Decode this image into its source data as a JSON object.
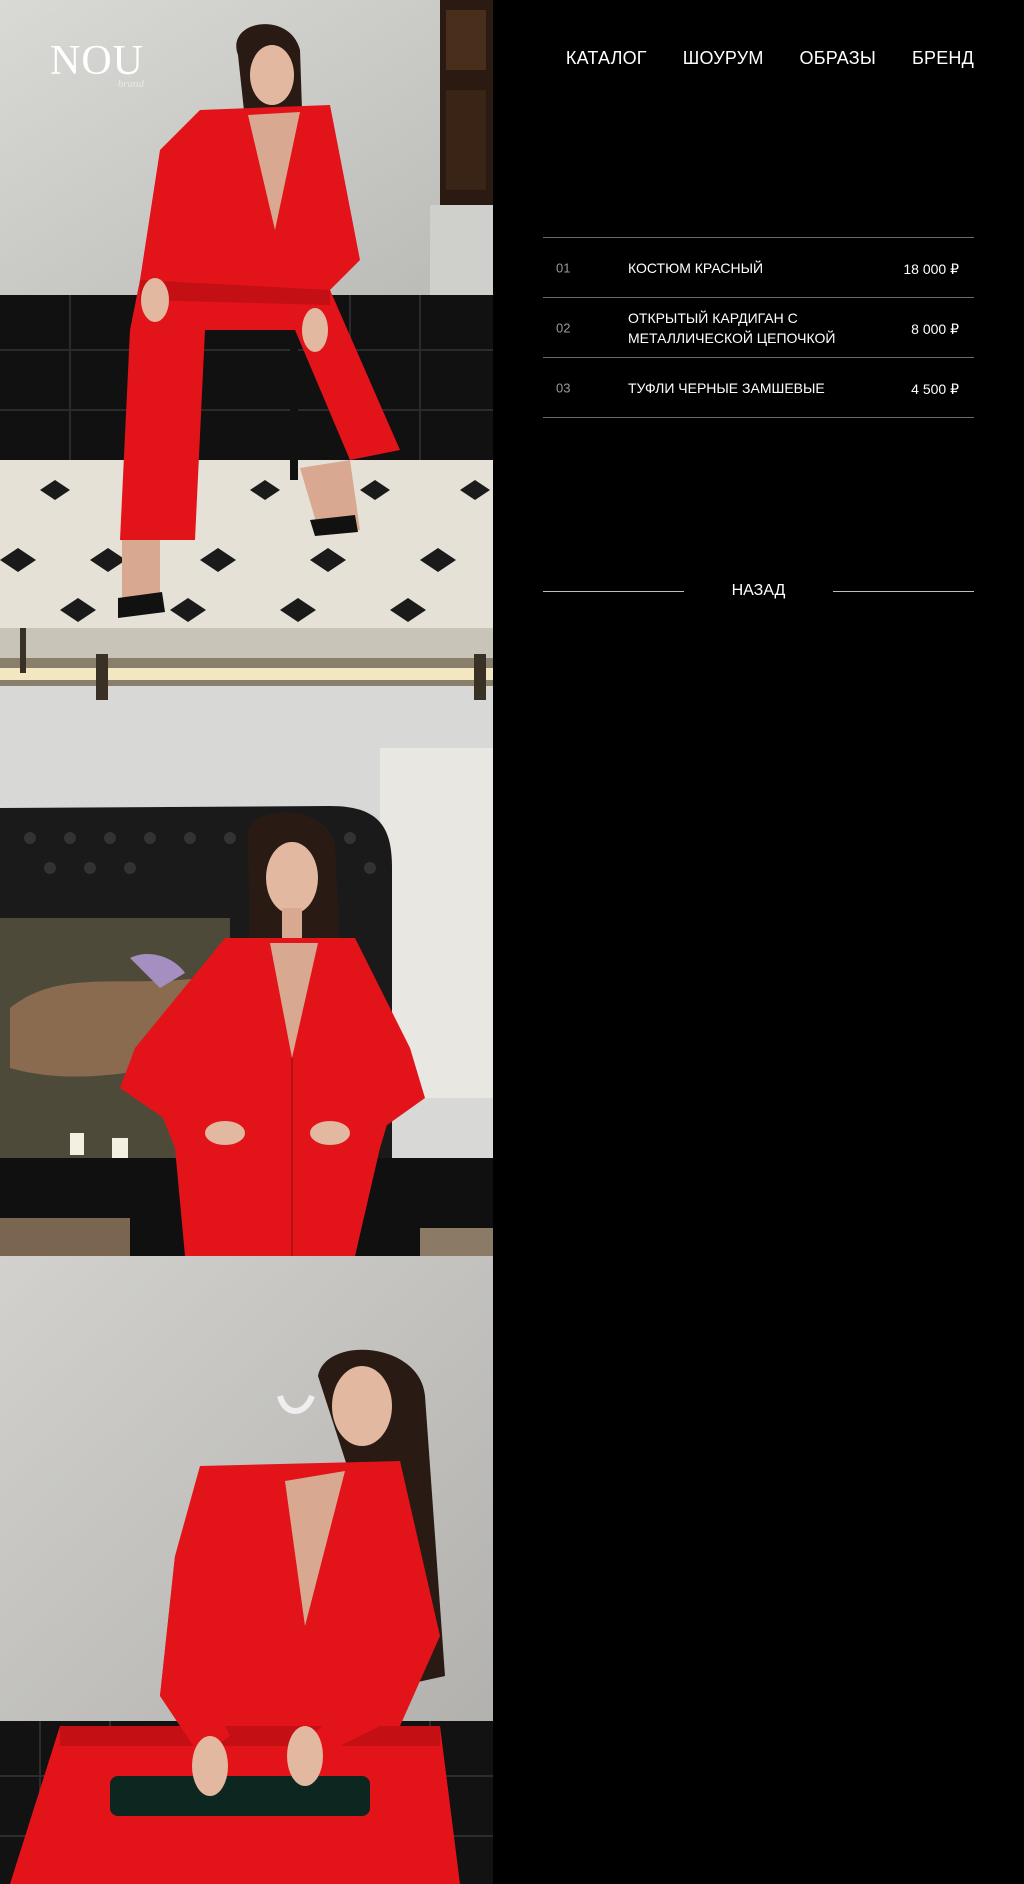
{
  "brand": {
    "logo_text": "NOU",
    "logo_sub": "brand"
  },
  "nav": {
    "items": [
      {
        "label": "КАТАЛОГ"
      },
      {
        "label": "ШОУРУМ"
      },
      {
        "label": "ОБРАЗЫ"
      },
      {
        "label": "БРЕНД"
      }
    ]
  },
  "products": [
    {
      "num": "01",
      "name": "КОСТЮМ КРАСНЫЙ",
      "price": "18 000 ₽"
    },
    {
      "num": "02",
      "name": "ОТКРЫТЫЙ КАРДИГАН С МЕТАЛЛИЧЕСКОЙ ЦЕПОЧКОЙ",
      "price": "8 000 ₽"
    },
    {
      "num": "03",
      "name": "ТУФЛИ ЧЕРНЫЕ ЗАМШЕВЫЕ",
      "price": "4 500 ₽"
    }
  ],
  "back_label": "НАЗАД",
  "colors": {
    "background": "#000000",
    "suit_red": "#e2141a",
    "divider": "#6a6a6a"
  }
}
